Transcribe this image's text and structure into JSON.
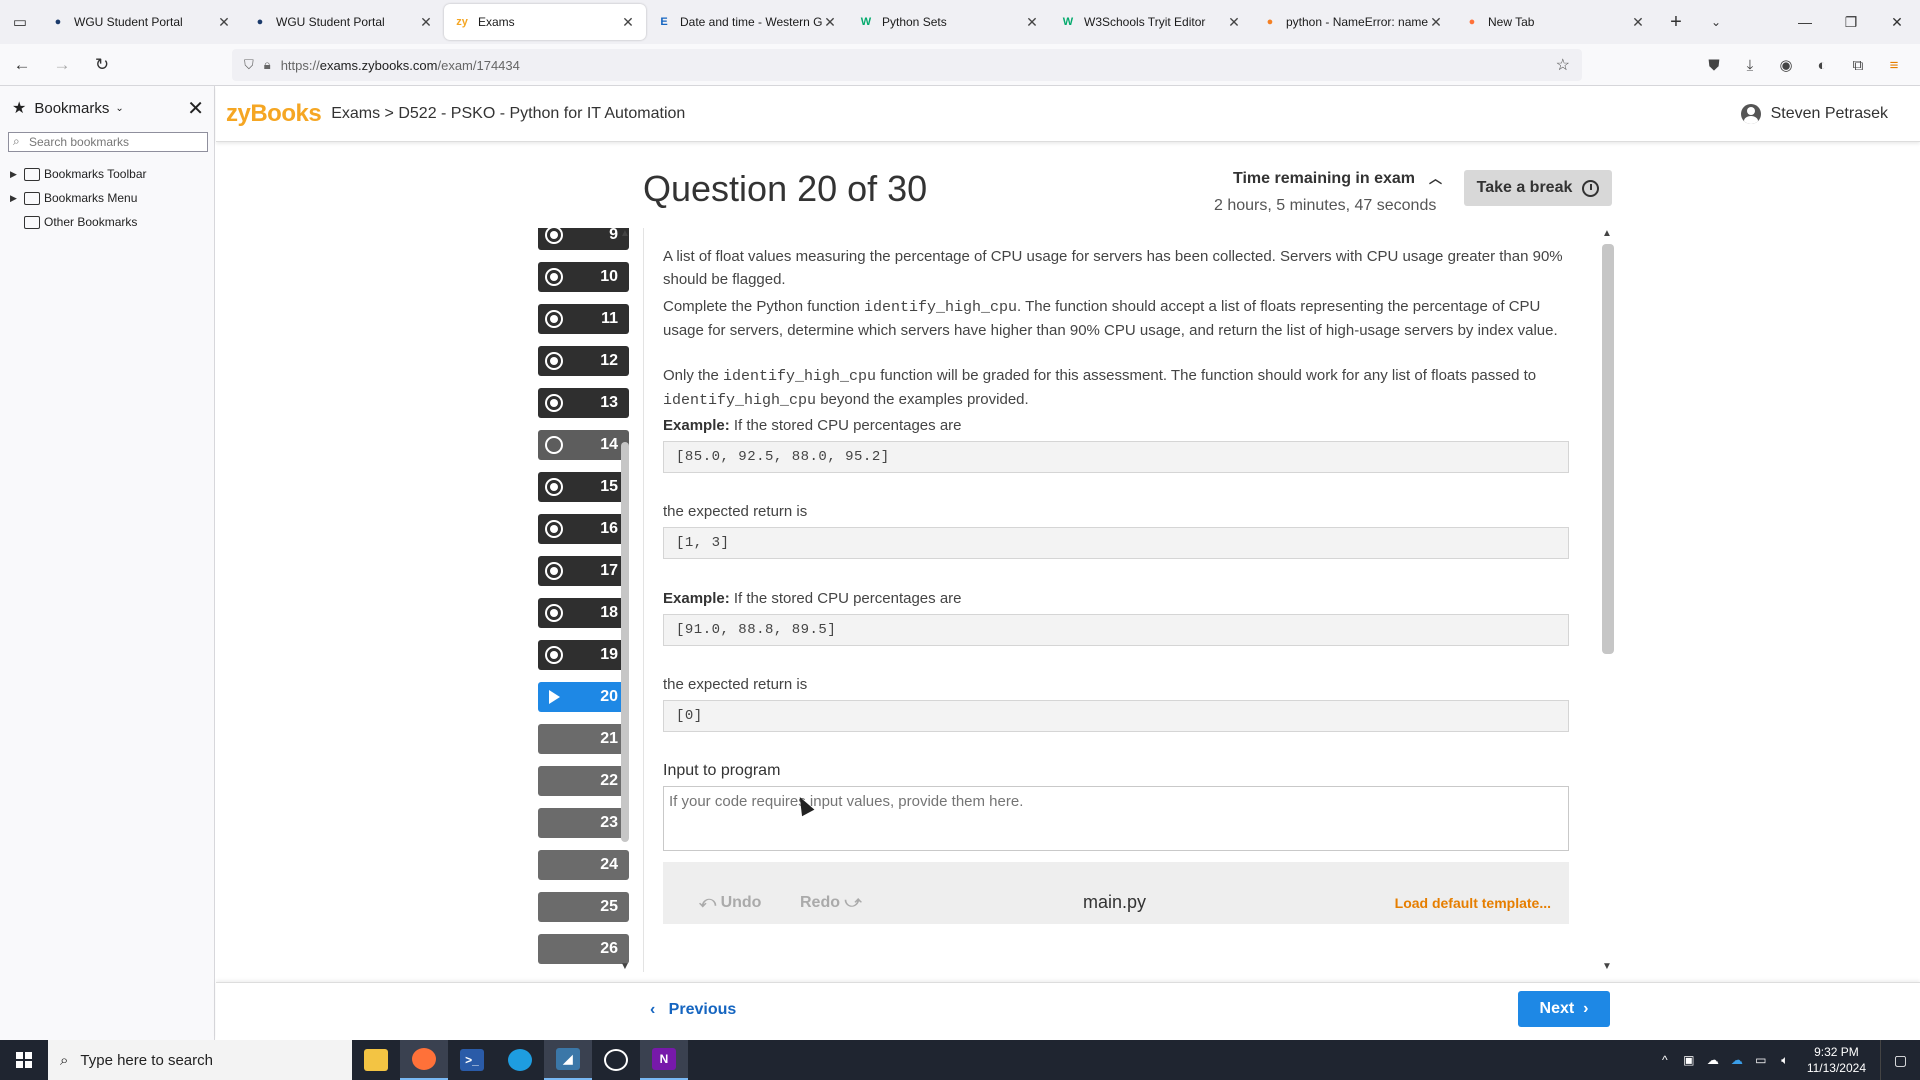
{
  "browser": {
    "tabs": [
      {
        "label": "WGU Student Portal",
        "icon": "owl-icon",
        "color": "#1b3a6b"
      },
      {
        "label": "WGU Student Portal",
        "icon": "owl-icon",
        "color": "#1b3a6b"
      },
      {
        "label": "Exams",
        "icon": "zybooks-icon",
        "color": "#f5a623",
        "active": true
      },
      {
        "label": "Date and time - Western Go",
        "icon": "wgu-e-icon",
        "color": "#1565c0"
      },
      {
        "label": "Python Sets",
        "icon": "w3schools-icon",
        "color": "#04aa6d"
      },
      {
        "label": "W3Schools Tryit Editor",
        "icon": "w3schools-icon",
        "color": "#04aa6d"
      },
      {
        "label": "python - NameError: name",
        "icon": "stackoverflow-icon",
        "color": "#f48024"
      },
      {
        "label": "New Tab",
        "icon": "firefox-icon",
        "color": "#ff7139"
      }
    ],
    "url_prefix": "https://",
    "url_host": "exams.zybooks.com",
    "url_path": "/exam/174434"
  },
  "bookmarks": {
    "title": "Bookmarks",
    "search_placeholder": "Search bookmarks",
    "items": [
      {
        "label": "Bookmarks Toolbar",
        "expandable": true
      },
      {
        "label": "Bookmarks Menu",
        "expandable": true
      },
      {
        "label": "Other Bookmarks",
        "expandable": false
      }
    ]
  },
  "header": {
    "logo": "zyBooks",
    "breadcrumb": "Exams > D522 - PSKO - Python for IT Automation",
    "user": "Steven Petrasek"
  },
  "exam": {
    "question_title": "Question 20 of 30",
    "timer_label": "Time remaining in exam",
    "timer_value": "2 hours, 5 minutes, 47 seconds",
    "break_label": "Take a break",
    "questions": [
      {
        "n": "9",
        "state": "answered"
      },
      {
        "n": "10",
        "state": "answered"
      },
      {
        "n": "11",
        "state": "answered"
      },
      {
        "n": "12",
        "state": "answered"
      },
      {
        "n": "13",
        "state": "answered"
      },
      {
        "n": "14",
        "state": "unanswered"
      },
      {
        "n": "15",
        "state": "answered"
      },
      {
        "n": "16",
        "state": "answered"
      },
      {
        "n": "17",
        "state": "answered"
      },
      {
        "n": "18",
        "state": "answered"
      },
      {
        "n": "19",
        "state": "answered"
      },
      {
        "n": "20",
        "state": "current"
      },
      {
        "n": "21",
        "state": "plain"
      },
      {
        "n": "22",
        "state": "plain"
      },
      {
        "n": "23",
        "state": "plain"
      },
      {
        "n": "24",
        "state": "plain"
      },
      {
        "n": "25",
        "state": "plain"
      },
      {
        "n": "26",
        "state": "plain"
      }
    ]
  },
  "question": {
    "p1": "A list of float values measuring the percentage of CPU usage for servers has been collected. Servers with CPU usage greater than 90% should be flagged.",
    "p2_a": "Complete the Python function ",
    "p2_code": "identify_high_cpu",
    "p2_b": ". The function should accept a list of floats representing the percentage of CPU usage for servers, determine which servers have higher than 90% CPU usage, and return the list of high-usage servers by index value.",
    "p3_a": "Only the ",
    "p3_code1": "identify_high_cpu",
    "p3_b": " function will be graded for this assessment. The function should work for any list of floats passed to ",
    "p3_code2": "identify_high_cpu",
    "p3_c": " beyond the examples provided.",
    "example_bold": "Example:",
    "example_text": " If the stored CPU percentages are",
    "example1_input": "[85.0, 92.5, 88.0, 95.2]",
    "expected_text": "the expected return is",
    "example1_output": "[1, 3]",
    "example2_input": "[91.0, 88.8, 89.5]",
    "example2_output": "[0]",
    "input_label": "Input to program",
    "input_placeholder": "If your code requires input values, provide them here.",
    "undo": "Undo",
    "redo": "Redo",
    "filename": "main.py",
    "load_template": "Load default template..."
  },
  "footer": {
    "previous": "Previous",
    "next": "Next"
  },
  "taskbar": {
    "search_placeholder": "Type here to search",
    "time": "9:32 PM",
    "date": "11/13/2024"
  }
}
